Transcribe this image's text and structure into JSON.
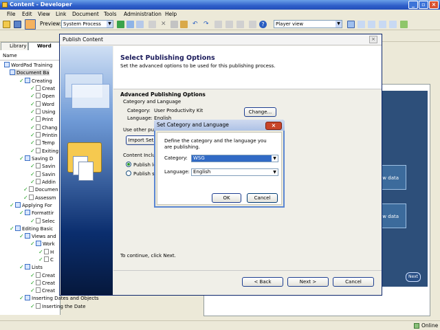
{
  "window": {
    "title": "Content - Developer"
  },
  "menu": [
    "File",
    "Edit",
    "View",
    "Link",
    "Document",
    "Tools",
    "Administration",
    "Help"
  ],
  "toolbar": {
    "preview_label": "Preview:",
    "preview_value": "System Process",
    "player_value": "Player view"
  },
  "left_tabs": [
    "Library",
    "Word"
  ],
  "outline": {
    "header": "Name",
    "nodes": [
      "WordPad Training",
      "Document Ba",
      "Creating",
      "Creat",
      "Open",
      "Word",
      "Using",
      "Print",
      "Chang",
      "Printin",
      "Temp",
      "Exiting",
      "Saving D",
      "Savin",
      "Savin",
      "Addin",
      "Documen",
      "Assessm",
      "Applying For",
      "Formattir",
      "Selec",
      "Editing Basic",
      "Views and",
      "Work",
      "H",
      "C",
      "Lists",
      "Creat",
      "Creat",
      "Creat",
      "Inserting Dates and Objects",
      "Inserting the Date"
    ]
  },
  "preview_slide": {
    "box1": "ew data",
    "box2": "ew data",
    "next": "Next"
  },
  "status": {
    "text": "Online"
  },
  "publish": {
    "title": "Publish Content",
    "close": "×",
    "header_title": "Select Publishing Options",
    "header_subtitle": "Set the advanced options to be used for this publishing process.",
    "advanced_title": "Advanced Publishing Options",
    "cat_lang_title": "Category and Language",
    "category_label": "Category:",
    "category_value": "User Productivity Kit",
    "language_label": "Language:",
    "language_value": "English",
    "change_button": "Change...",
    "use_other": "Use other publi",
    "import_button": "Import Set",
    "content_include": "Content Includ",
    "radio1": "Publish lo",
    "radio2": "Publish se",
    "continue_text": "To continue, click Next.",
    "back_button": "< Back",
    "next_button": "Next >",
    "cancel_button": "Cancel"
  },
  "setcat": {
    "title": "Set Category and Language",
    "close": "×",
    "description": "Define the category and the language you are publishing.",
    "category_label": "Category:",
    "category_value": "WSG",
    "language_label": "Language:",
    "language_value": "English",
    "ok_button": "OK",
    "cancel_button": "Cancel"
  }
}
